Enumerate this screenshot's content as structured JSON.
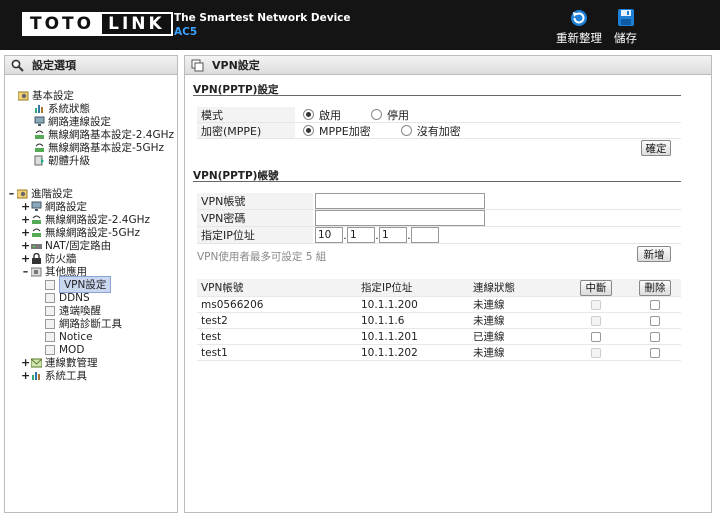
{
  "header": {
    "logo_left": "TOTO",
    "logo_right": "LINK",
    "tagline": "The Smartest Network Device",
    "model": "AC5",
    "refresh_label": "重新整理",
    "save_label": "儲存"
  },
  "sidebar": {
    "title": "設定選項",
    "basic": {
      "label": "基本設定",
      "items": [
        "系統狀態",
        "網路連線設定",
        "無線網路基本設定-2.4GHz",
        "無線網路基本設定-5GHz",
        "韌體升級"
      ]
    },
    "advanced": {
      "label": "進階設定",
      "items": [
        "網路設定",
        "無線網路設定-2.4GHz",
        "無線網路設定-5GHz",
        "NAT/固定路由",
        "防火牆"
      ],
      "other": {
        "label": "其他應用",
        "items": [
          "VPN設定",
          "DDNS",
          "遠端喚醒",
          "網路診斷工具",
          "Notice",
          "MOD"
        ]
      },
      "tail": [
        "連線數管理",
        "系統工具"
      ]
    }
  },
  "main": {
    "title": "VPN設定",
    "pptp_section": "VPN(PPTP)設定",
    "mode_label": "模式",
    "mode_on": "啟用",
    "mode_off": "停用",
    "enc_label": "加密(MPPE)",
    "enc_on": "MPPE加密",
    "enc_off": "沒有加密",
    "confirm_label": "確定",
    "account_section": "VPN(PPTP)帳號",
    "account_label": "VPN帳號",
    "password_label": "VPN密碼",
    "ip_label": "指定IP位址",
    "ip_values": [
      "10",
      "1",
      "1",
      ""
    ],
    "note": "VPN使用者最多可設定 5 組",
    "add_label": "新增",
    "table": {
      "headers": [
        "VPN帳號",
        "指定IP位址",
        "連線狀態",
        "中斷",
        "刪除"
      ],
      "rows": [
        {
          "account": "ms0566206",
          "ip": "10.1.1.200",
          "status": "未連線"
        },
        {
          "account": "test2",
          "ip": "10.1.1.6",
          "status": "未連線"
        },
        {
          "account": "test",
          "ip": "10.1.1.201",
          "status": "已連線"
        },
        {
          "account": "test1",
          "ip": "10.1.1.202",
          "status": "未連線"
        }
      ]
    }
  }
}
